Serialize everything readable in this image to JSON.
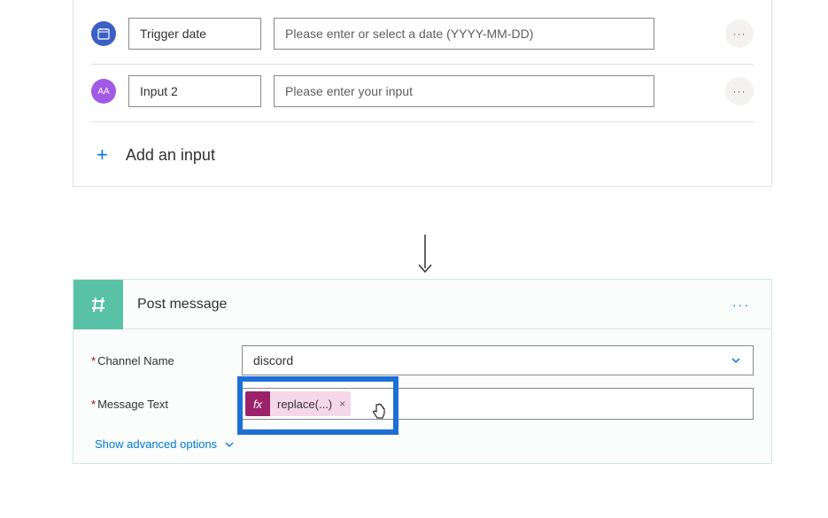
{
  "trigger_card": {
    "rows": [
      {
        "icon_text": "",
        "icon_class": "icon-blue",
        "name": "Trigger date",
        "placeholder": "Please enter or select a date (YYYY-MM-DD)"
      },
      {
        "icon_text": "AA",
        "icon_class": "icon-purple",
        "name": "Input 2",
        "placeholder": "Please enter your input"
      }
    ],
    "add_input_label": "Add an input"
  },
  "post_card": {
    "title": "Post message",
    "channel_label": "Channel Name",
    "channel_value": "discord",
    "message_label": "Message Text",
    "fx_label": "replace(...)",
    "fx_badge": "fx",
    "advanced_label": "Show advanced options"
  },
  "glyphs": {
    "more": "···",
    "plus": "+",
    "chevron": "⌄",
    "close": "×"
  }
}
